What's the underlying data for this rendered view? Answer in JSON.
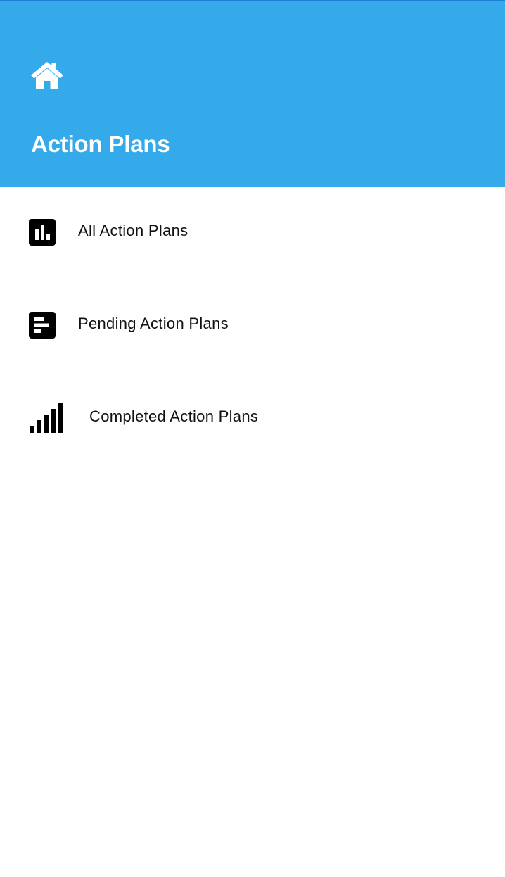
{
  "header": {
    "title": "Action Plans",
    "home_icon": "home-icon",
    "background_color": "#34aaeb",
    "title_color": "#ffffff"
  },
  "menu": {
    "items": [
      {
        "label": "All Action Plans",
        "icon": "bar-chart-square-icon"
      },
      {
        "label": "Pending Action Plans",
        "icon": "list-square-icon"
      },
      {
        "label": "Completed Action Plans",
        "icon": "signal-bars-icon"
      }
    ]
  }
}
